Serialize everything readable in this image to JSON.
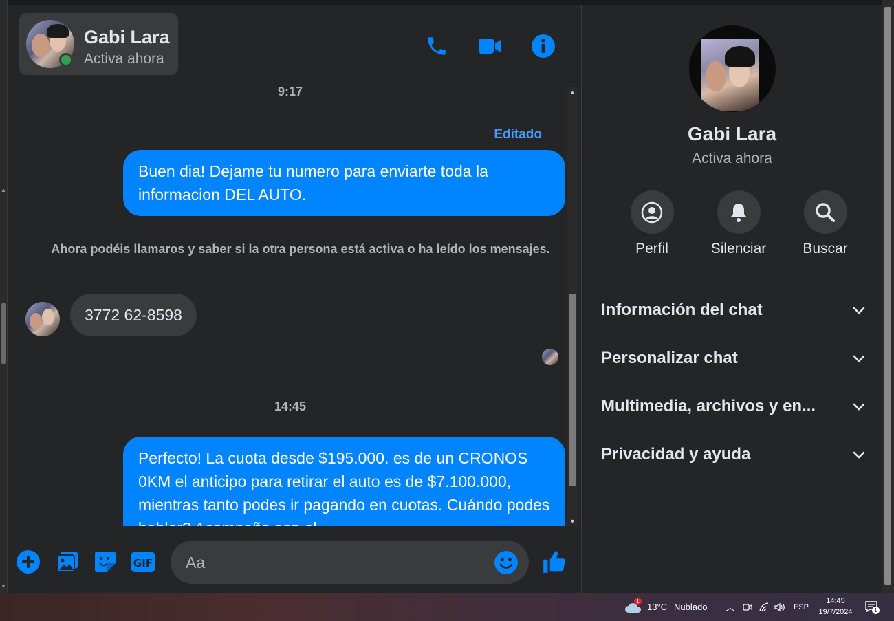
{
  "contact": {
    "name": "Gabi Lara",
    "status": "Activa ahora"
  },
  "header_actions": [
    "phone-icon",
    "video-icon",
    "info-icon"
  ],
  "accent_color": "#0084ff",
  "messages": {
    "time_1": "9:17",
    "edited_label": "Editado",
    "outgoing_1": "Buen dia! Dejame tu numero para enviarte toda la informacion DEL AUTO.",
    "system_note": "Ahora podéis llamaros y saber si la otra persona está activa o ha leído los mensajes.",
    "incoming_1": "3772 62-8598",
    "time_2": "14:45",
    "outgoing_2": "Perfecto! La cuota desde $195.000. es de un CRONOS 0KM el anticipo para retirar el auto es de $7.100.000, mientras tanto podes ir pagando en cuotas. Cuándo podes hablar? Acompaño con el"
  },
  "composer": {
    "placeholder": "Aa",
    "icons": [
      "plus-icon",
      "photo-icon",
      "sticker-icon",
      "gif-icon",
      "emoji-icon",
      "like-icon"
    ]
  },
  "info_panel": {
    "actions": [
      {
        "label": "Perfil",
        "icon": "profile-icon"
      },
      {
        "label": "Silenciar",
        "icon": "bell-icon"
      },
      {
        "label": "Buscar",
        "icon": "search-icon"
      }
    ],
    "sections": [
      {
        "label": "Información del chat"
      },
      {
        "label": "Personalizar chat"
      },
      {
        "label": "Multimedia, archivos y en..."
      },
      {
        "label": "Privacidad y ayuda"
      }
    ]
  },
  "taskbar": {
    "weather_temp": "13°C",
    "weather_desc": "Nublado",
    "weather_badge": "1",
    "language": "ESP",
    "time": "14:45",
    "date": "19/7/2024",
    "notification_count": "1"
  }
}
